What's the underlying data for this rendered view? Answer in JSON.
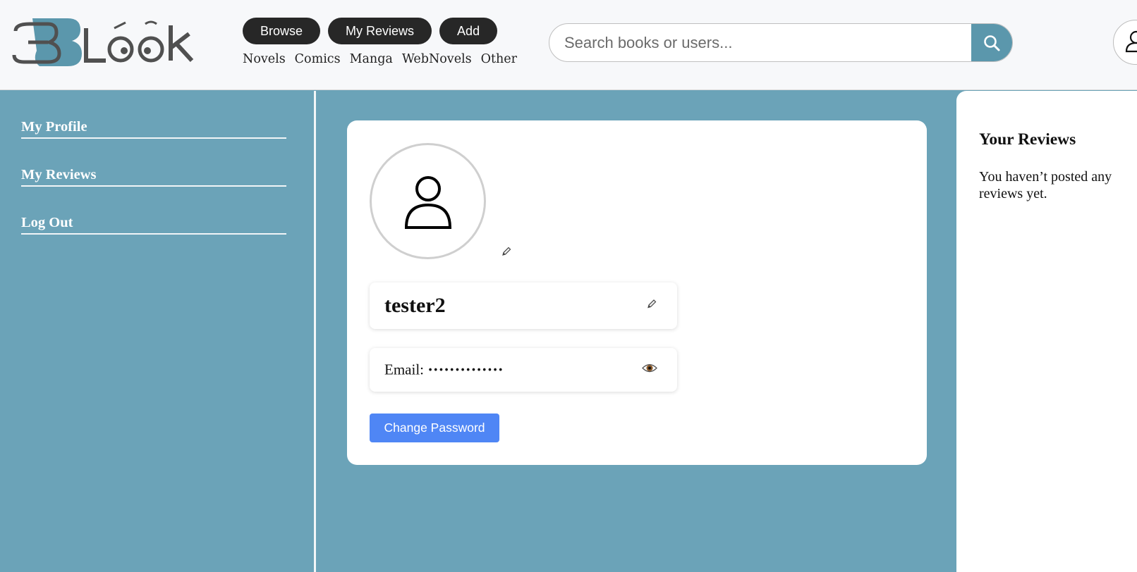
{
  "header": {
    "logo_text": "BLook",
    "pills": [
      "Browse",
      "My Reviews",
      "Add"
    ],
    "categories": [
      "Novels",
      "Comics",
      "Manga",
      "WebNovels",
      "Other"
    ],
    "search_placeholder": "Search books or users..."
  },
  "sidebar": {
    "items": [
      "My Profile",
      "My Reviews",
      "Log Out"
    ]
  },
  "profile": {
    "username": "tester2",
    "email_label": "Email:",
    "email_masked": "••••••••••••••",
    "change_password_label": "Change Password"
  },
  "reviews": {
    "title": "Your Reviews",
    "empty_text": "You haven’t posted any reviews yet."
  },
  "colors": {
    "background": "#6ba3b8",
    "search_button": "#5b97ac",
    "pill": "#272727",
    "primary_button": "#4f86f5"
  },
  "icons": [
    "search-icon",
    "user-icon",
    "pencil-icon",
    "eye-icon"
  ]
}
